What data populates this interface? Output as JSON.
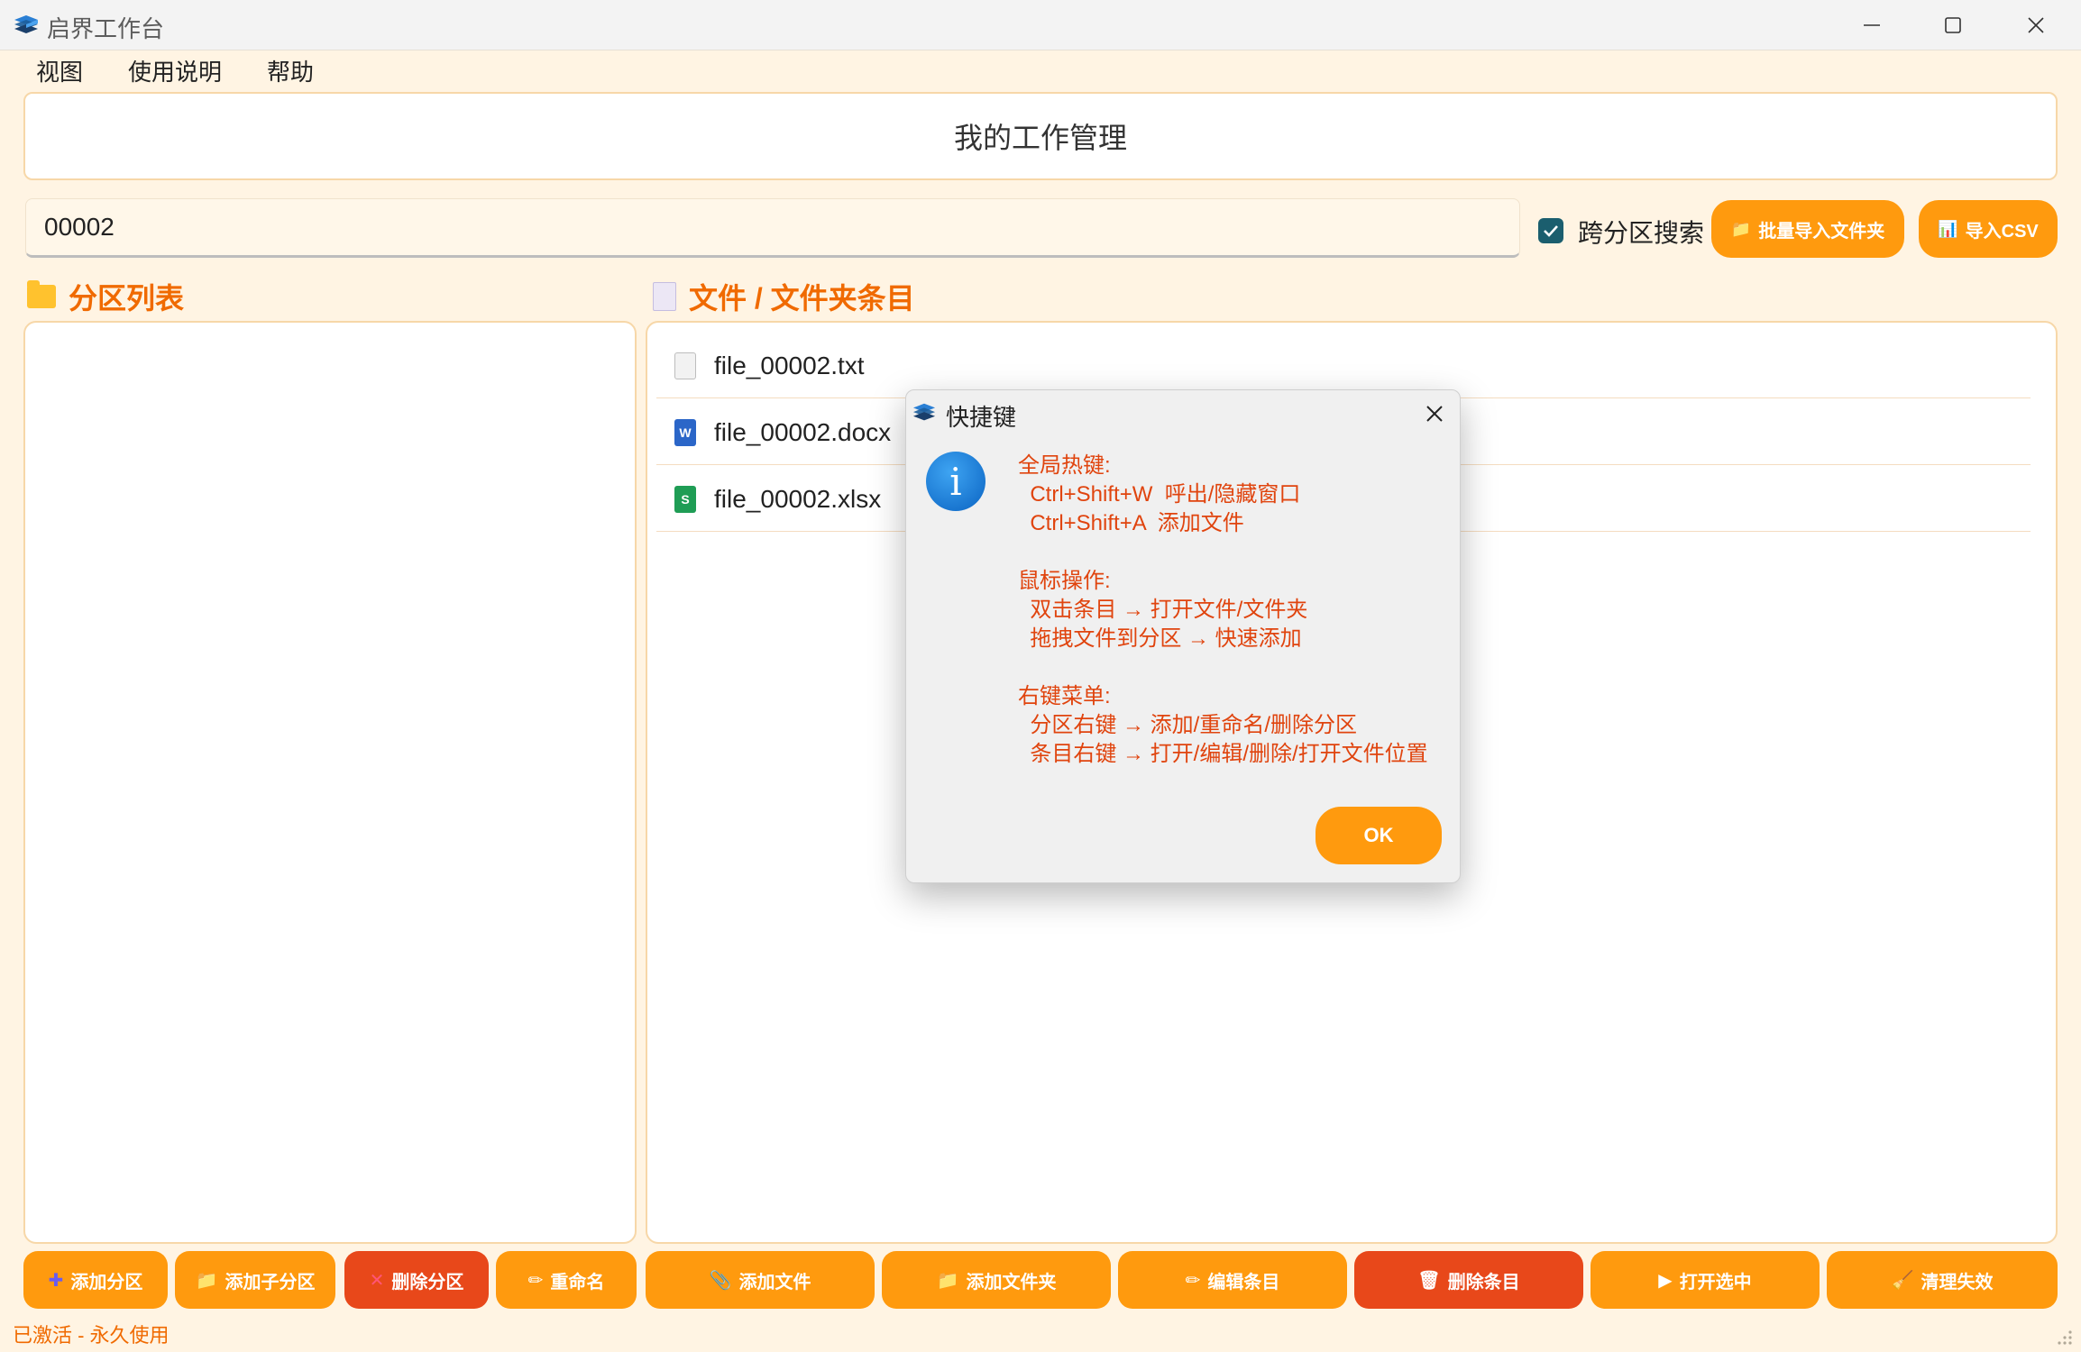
{
  "window": {
    "title": "启界工作台",
    "icon": "books-stack-icon"
  },
  "menu": {
    "items": [
      "视图",
      "使用说明",
      "帮助"
    ]
  },
  "header": {
    "title": "我的工作管理"
  },
  "search": {
    "value": "00002",
    "cross_search_label": "跨分区搜索",
    "cross_search_checked": true
  },
  "toolbar": {
    "import_folder_label": "批量导入文件夹",
    "import_csv_label": "导入CSV"
  },
  "partitions": {
    "title": "分区列表",
    "items": []
  },
  "files": {
    "title": "文件 / 文件夹条目",
    "items": [
      {
        "name": "file_00002.txt",
        "icon": "text-file-icon"
      },
      {
        "name": "file_00002.docx",
        "icon": "word-file-icon"
      },
      {
        "name": "file_00002.xlsx",
        "icon": "spreadsheet-file-icon"
      }
    ]
  },
  "bottom_buttons": {
    "add_partition": "添加分区",
    "add_subpartition": "添加子分区",
    "delete_partition": "删除分区",
    "rename": "重命名",
    "add_file": "添加文件",
    "add_folder": "添加文件夹",
    "edit_item": "编辑条目",
    "delete_item": "删除条目",
    "open_selected": "打开选中",
    "clean_invalid": "清理失效"
  },
  "status": {
    "text": "已激活 - 永久使用"
  },
  "dialog": {
    "title": "快捷键",
    "body": "全局热键:\n  Ctrl+Shift+W  呼出/隐藏窗口\n  Ctrl+Shift+A  添加文件\n\n鼠标操作:\n  双击条目 → 打开文件/文件夹\n  拖拽文件到分区 → 快速添加\n\n右键菜单:\n  分区右键 → 添加/重命名/删除分区\n  条目右键 → 打开/编辑/删除/打开文件位置",
    "ok_label": "OK"
  },
  "colors": {
    "accent": "#ff9a0e",
    "danger": "#e8481a",
    "heading": "#f06a00",
    "background": "#fff4e3"
  }
}
